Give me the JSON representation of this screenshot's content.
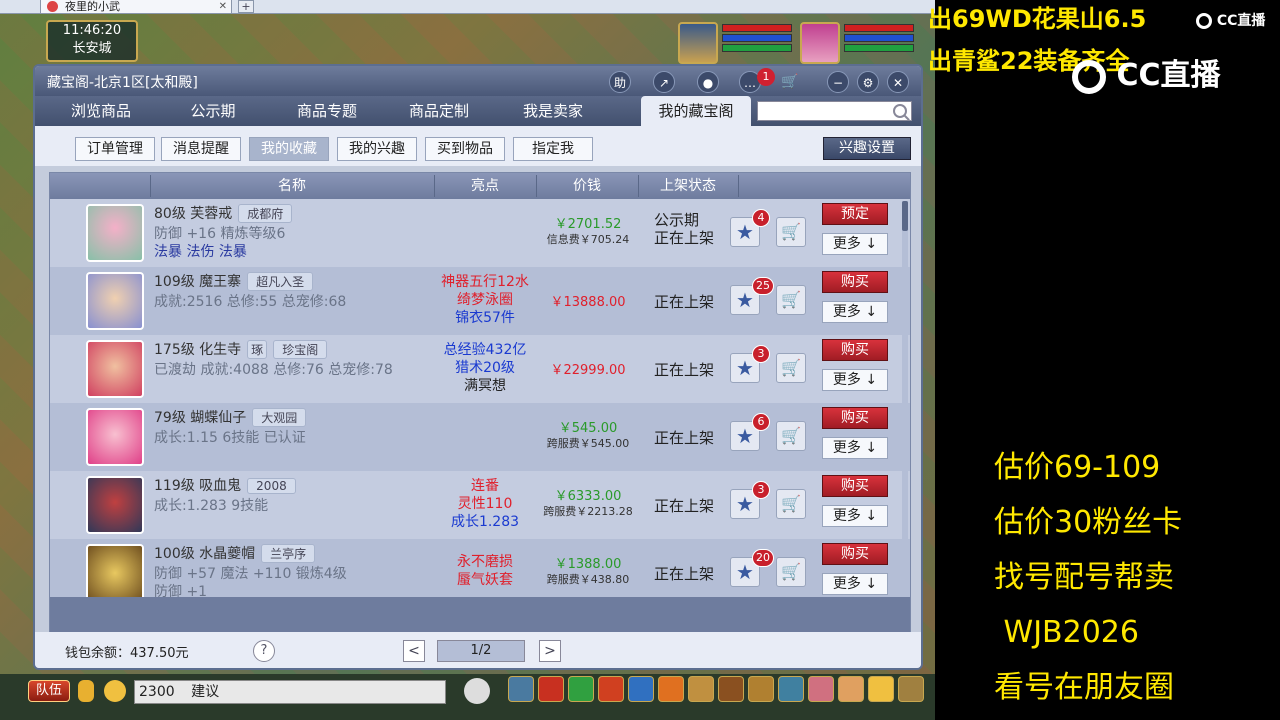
{
  "browser_tab": {
    "title": "夜里的小武",
    "close": "✕",
    "new_tab": "+"
  },
  "game": {
    "clock_time": "11:46:20",
    "location": "长安城"
  },
  "window": {
    "title": "藏宝阁-北京1区[太和殿]",
    "icons": {
      "help": "助",
      "share": "↗",
      "record": "●",
      "chat": "…",
      "chat_badge": "1",
      "cart": "🛒",
      "minimize": "−",
      "settings": "⚙",
      "close": "✕"
    },
    "nav_tabs": [
      "浏览商品",
      "公示期",
      "商品专题",
      "商品定制",
      "我是卖家",
      "我的藏宝阁"
    ],
    "search_placeholder": "",
    "sub_tabs": [
      "订单管理",
      "消息提醒",
      "我的收藏",
      "我的兴趣",
      "买到物品",
      "指定我"
    ],
    "interest_settings": "兴趣设置",
    "columns": {
      "name": "名称",
      "highlight": "亮点",
      "price": "价钱",
      "status": "上架状态"
    },
    "rows": [
      {
        "title": "80级 芙蓉戒",
        "tag": "成都府",
        "line2": "防御 +16 精炼等级6",
        "line3": "法暴 法伤 法暴",
        "highlights": [],
        "price": "￥2701.52",
        "fee": "信息费￥705.24",
        "status": [
          "公示期",
          "正在上架"
        ],
        "fav_count": "4",
        "action": "预定",
        "more": "更多 ↓"
      },
      {
        "title": "109级 魔王寨",
        "tag": "超凡入圣",
        "line2": "成就:2516 总修:55 总宠修:68",
        "line3": "",
        "highlights": [
          "神器五行12水",
          "绮梦泳圈",
          "锦衣57件"
        ],
        "price": "￥13888.00",
        "fee": "",
        "status": [
          "正在上架"
        ],
        "fav_count": "25",
        "action": "购买",
        "more": "更多 ↓"
      },
      {
        "title": "175级 化生寺",
        "tag": "珍宝阁",
        "tag_extra": "琢",
        "line2": "已渡劫 成就:4088 总修:76 总宠修:78",
        "line3": "",
        "highlights": [
          "总经验432亿",
          "猎术20级",
          "满冥想"
        ],
        "price": "￥22999.00",
        "fee": "",
        "status": [
          "正在上架"
        ],
        "fav_count": "3",
        "action": "购买",
        "more": "更多 ↓"
      },
      {
        "title": "79级 蝴蝶仙子",
        "tag": "大观园",
        "line2": "成长:1.15 6技能 已认证",
        "line3": "",
        "highlights": [],
        "price": "￥545.00",
        "fee": "跨服费￥545.00",
        "status": [
          "正在上架"
        ],
        "fav_count": "6",
        "action": "购买",
        "more": "更多 ↓"
      },
      {
        "title": "119级 吸血鬼",
        "tag": "2008",
        "line2": "成长:1.283 9技能",
        "line3": "",
        "highlights": [
          "连番",
          "灵性110",
          "成长1.283"
        ],
        "price": "￥6333.00",
        "fee": "跨服费￥2213.28",
        "status": [
          "正在上架"
        ],
        "fav_count": "3",
        "action": "购买",
        "more": "更多 ↓"
      },
      {
        "title": "100级 水晶夔帽",
        "tag": "兰亭序",
        "line2": "防御 +57 魔法 +110 锻炼4级",
        "line3": "防御 +1",
        "highlights": [
          "永不磨损",
          "蜃气妖套"
        ],
        "price": "￥1388.00",
        "fee": "跨服费￥438.80",
        "status": [
          "正在上架"
        ],
        "fav_count": "20",
        "action": "购买",
        "more": "更多 ↓"
      }
    ],
    "wallet": "钱包余额：437.50元",
    "help": "?",
    "page": "1/2",
    "prev": "<",
    "next": ">"
  },
  "chat": {
    "team": "队伍",
    "channel_value": "2300",
    "input_text": "建议"
  },
  "overlay": {
    "line1": "出69WD花果山6.5",
    "line2": "出青鲨22装备齐全",
    "logo_small": "CC直播",
    "logo_big": "CC直播",
    "estimates": [
      "估价69-109",
      "估价30粉丝卡",
      "找号配号帮卖",
      " WJB2026",
      "看号在朋友圈"
    ]
  },
  "colors": {
    "accent_red": "#e0202c",
    "highlight_blue": "#1a3ad0",
    "price_red": "#e0202c",
    "price_green": "#2a9a2a",
    "overlay_yellow": "#ffe800"
  }
}
